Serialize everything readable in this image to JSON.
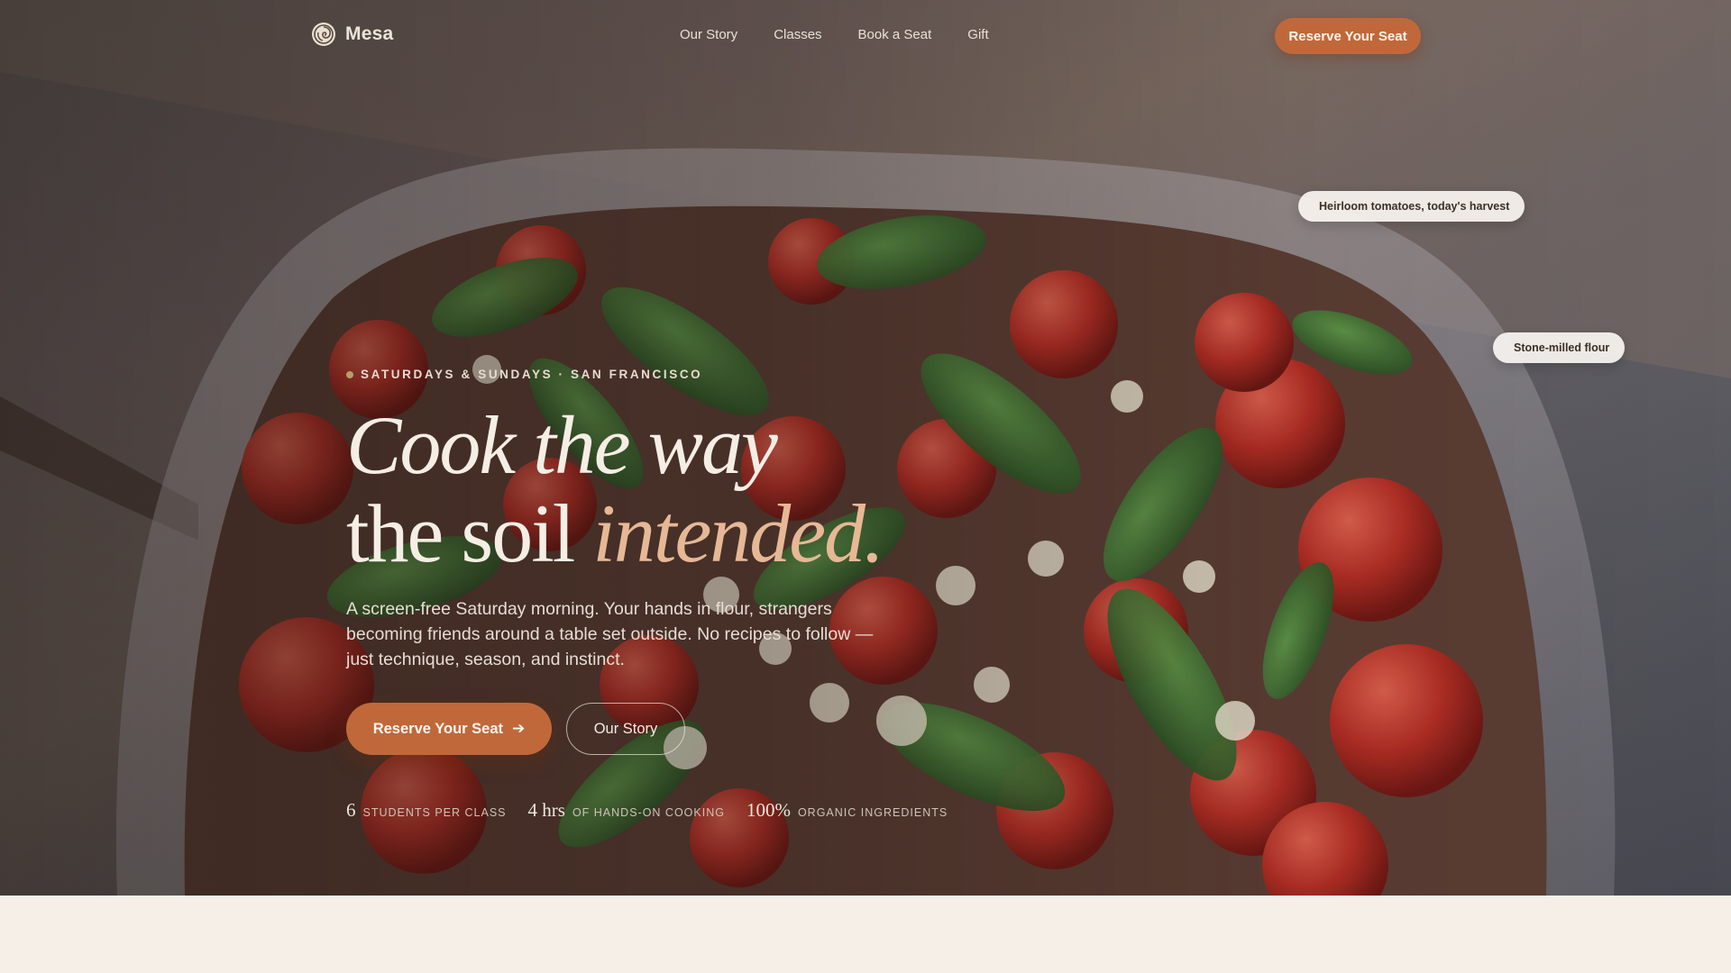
{
  "colors": {
    "accent": "#c0683a",
    "accent_text": "#e6b896",
    "page_bg": "#f5efe7",
    "hero_text": "#f5eee5"
  },
  "nav": {
    "brand": "Mesa",
    "brand_icon": "spiral-logo-icon",
    "links": [
      "Our Story",
      "Classes",
      "Book a Seat",
      "Gift"
    ],
    "cta": "Reserve Your Seat"
  },
  "float_tags": [
    {
      "icon": "",
      "text": "Heirloom tomatoes, today's harvest"
    },
    {
      "icon": "",
      "text": "Stone-milled flour"
    }
  ],
  "hero": {
    "eyebrow": "SATURDAYS & SUNDAYS · SAN FRANCISCO",
    "headline_line1": "Cook the way",
    "headline_line2_plain": "the soil ",
    "headline_line2_accent": "intended.",
    "lede": "A screen-free Saturday morning. Your hands in flour, strangers becoming friends around a table set outside. No recipes to follow — just technique, season, and instinct.",
    "primary_button": "Reserve Your Seat",
    "primary_button_icon": "arrow-right-icon",
    "secondary_button": "Our Story"
  },
  "stats": [
    {
      "value": "6",
      "label": "STUDENTS PER CLASS"
    },
    {
      "value": "4 hrs",
      "label": "OF HANDS-ON COOKING"
    },
    {
      "value": "100%",
      "label": "ORGANIC INGREDIENTS"
    }
  ]
}
